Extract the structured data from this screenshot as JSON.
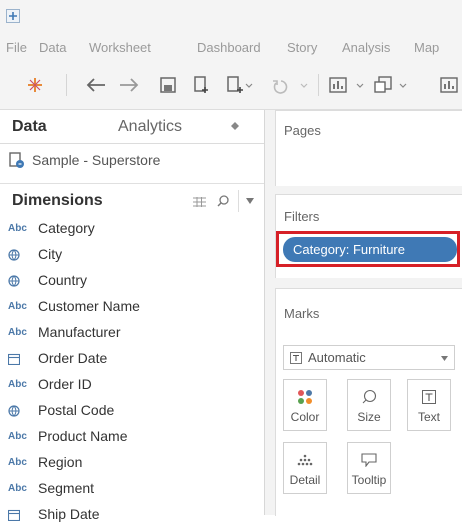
{
  "menu": [
    "File",
    "Data",
    "Worksheet",
    "Dashboard",
    "Story",
    "Analysis",
    "Map"
  ],
  "toolbar": {
    "icons": [
      "tableau-logo-icon",
      "back-arrow-icon",
      "forward-arrow-icon",
      "save-icon",
      "new-datasource-icon",
      "new-worksheet-icon",
      "undo-icon",
      "show-me-icon",
      "highlight-icon",
      "chart-icon"
    ]
  },
  "data_pane": {
    "tabs": {
      "data": "Data",
      "analytics": "Analytics"
    },
    "datasource": "Sample - Superstore",
    "dimensions_title": "Dimensions",
    "fields": [
      {
        "type": "Abc",
        "icon": "string-type-icon",
        "name": "Category"
      },
      {
        "type": "geo",
        "icon": "globe-icon",
        "name": "City"
      },
      {
        "type": "geo",
        "icon": "globe-icon",
        "name": "Country"
      },
      {
        "type": "Abc",
        "icon": "string-type-icon",
        "name": "Customer Name"
      },
      {
        "type": "Abc",
        "icon": "string-type-icon",
        "name": "Manufacturer"
      },
      {
        "type": "date",
        "icon": "calendar-icon",
        "name": "Order Date"
      },
      {
        "type": "Abc",
        "icon": "string-type-icon",
        "name": "Order ID"
      },
      {
        "type": "geo",
        "icon": "globe-icon",
        "name": "Postal Code"
      },
      {
        "type": "Abc",
        "icon": "string-type-icon",
        "name": "Product Name"
      },
      {
        "type": "Abc",
        "icon": "string-type-icon",
        "name": "Region"
      },
      {
        "type": "Abc",
        "icon": "string-type-icon",
        "name": "Segment"
      },
      {
        "type": "date",
        "icon": "calendar-icon",
        "name": "Ship Date"
      }
    ]
  },
  "shelves": {
    "pages_title": "Pages",
    "filters_title": "Filters",
    "filter_pill": "Category: Furniture",
    "marks_title": "Marks",
    "mark_type": "Automatic",
    "mark_buttons": [
      {
        "label": "Color",
        "icon": "color-dots-icon"
      },
      {
        "label": "Size",
        "icon": "size-icon"
      },
      {
        "label": "Text",
        "icon": "text-icon"
      },
      {
        "label": "Detail",
        "icon": "detail-icon"
      },
      {
        "label": "Tooltip",
        "icon": "tooltip-icon"
      }
    ]
  },
  "colors": {
    "accent": "#3f79b5",
    "highlight": "#d62027",
    "field_icon": "#4b78a8"
  }
}
